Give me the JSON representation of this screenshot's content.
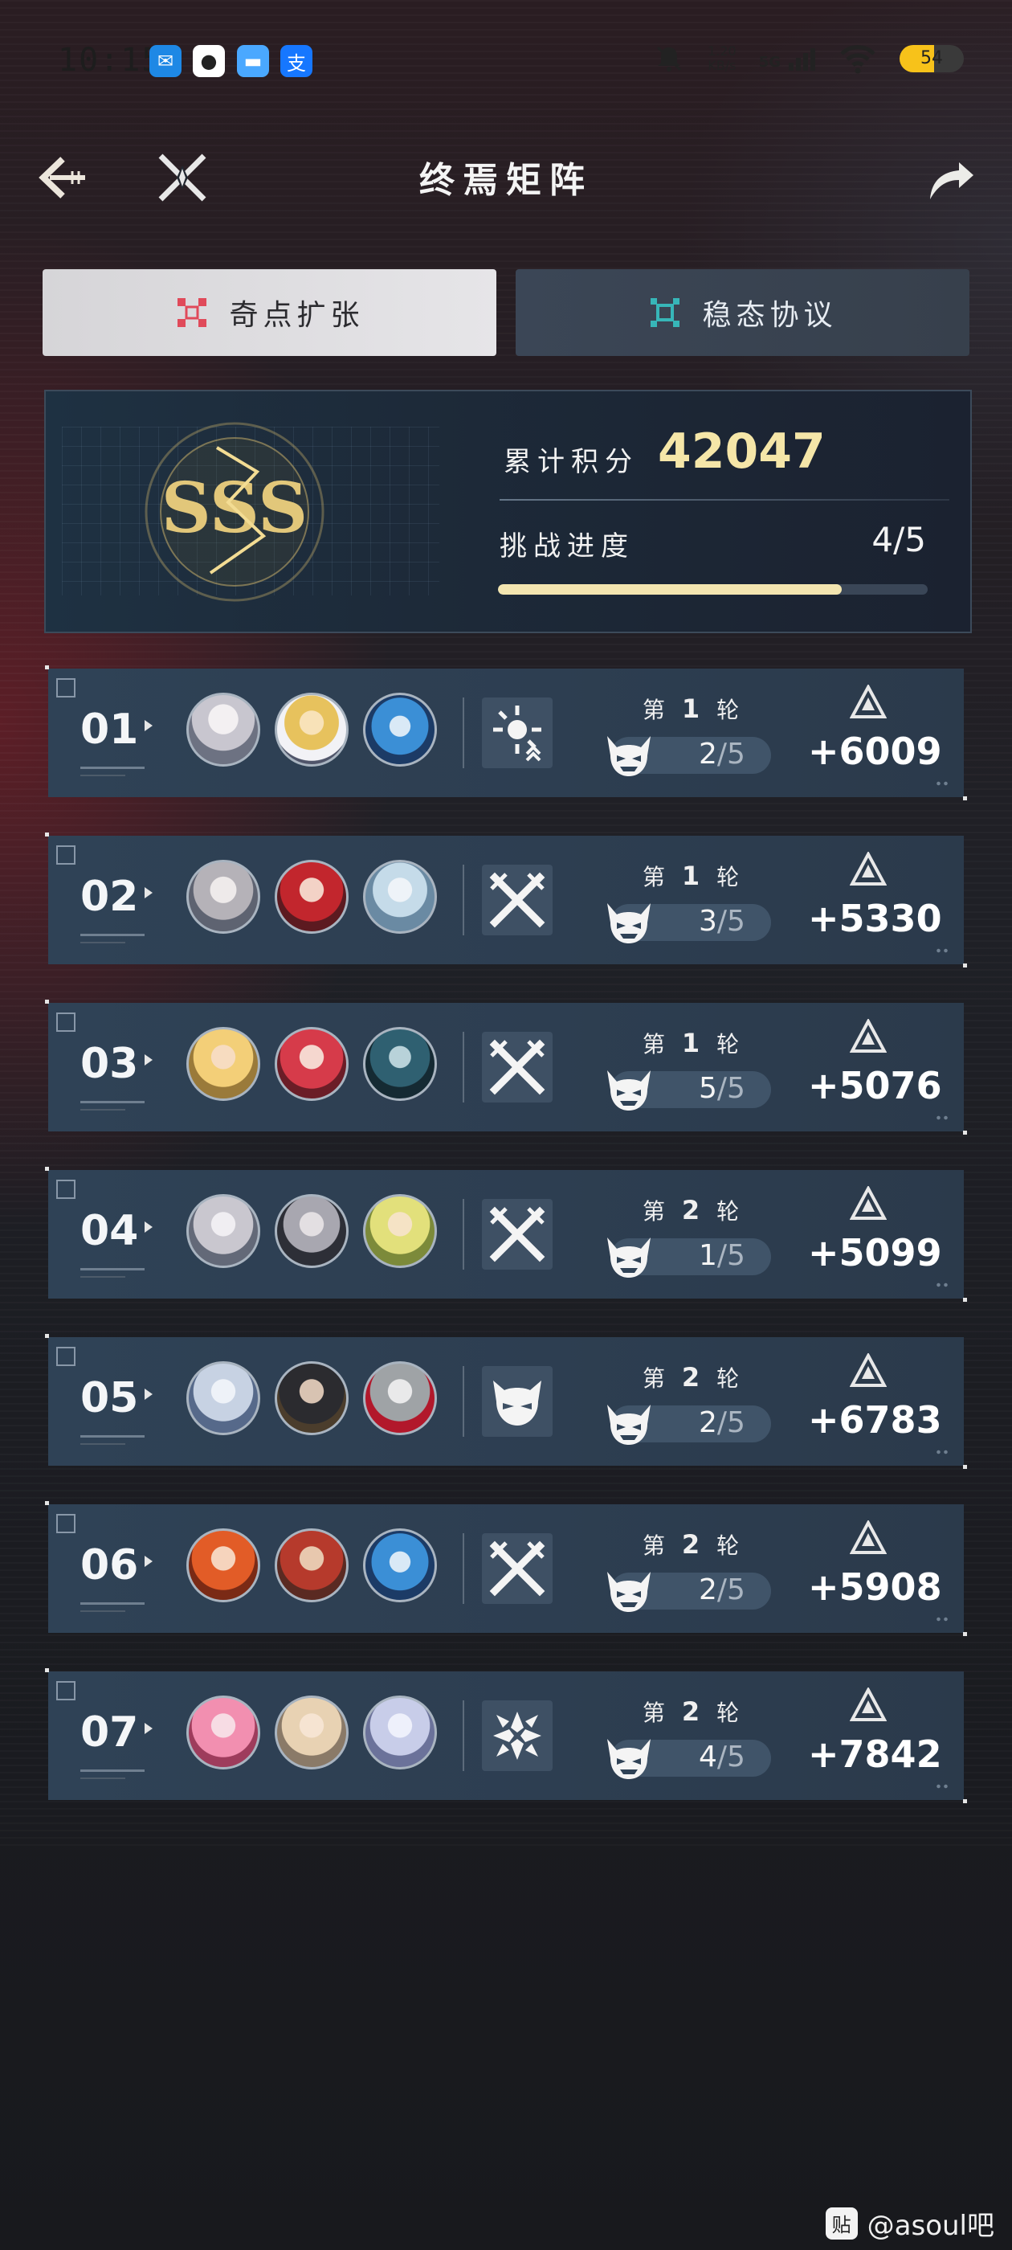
{
  "status_bar": {
    "time": "10:15",
    "net_speed": "1.20\nKB/s",
    "signal": "5G",
    "battery": "54",
    "battery_level": 0.54,
    "notifications": [
      "message-app-icon",
      "qq-icon",
      "wallet-card-icon",
      "alipay-icon"
    ]
  },
  "header": {
    "title": "终焉矩阵",
    "back_icon": "back-arrow-icon",
    "cross_icon": "crossed-swords-icon",
    "share_icon": "share-arrow-icon"
  },
  "tabs": [
    {
      "label": "奇点扩张",
      "icon": "singularity-icon",
      "active": true,
      "accent": "#e04a5a"
    },
    {
      "label": "稳态协议",
      "icon": "stable-protocol-icon",
      "active": false,
      "accent": "#37b6b8"
    }
  ],
  "summary": {
    "rank": "SSS",
    "score_label": "累计积分",
    "score": "42047",
    "progress_label": "挑战进度",
    "progress": "4/5",
    "progress_fraction": 0.8
  },
  "stages": [
    {
      "num": "01",
      "round": "1",
      "attempts": "2",
      "max": "/5",
      "score": "+6009",
      "buff_icon": "radiant-sun-icon",
      "avatars": [
        "av-a",
        "av-b",
        "av-c"
      ]
    },
    {
      "num": "02",
      "round": "1",
      "attempts": "3",
      "max": "/5",
      "score": "+5330",
      "buff_icon": "crossed-blades-icon",
      "avatars": [
        "av-d",
        "av-e",
        "av-f"
      ]
    },
    {
      "num": "03",
      "round": "1",
      "attempts": "5",
      "max": "/5",
      "score": "+5076",
      "buff_icon": "crossed-blades-icon",
      "avatars": [
        "av-g",
        "av-h",
        "av-i"
      ]
    },
    {
      "num": "04",
      "round": "2",
      "attempts": "1",
      "max": "/5",
      "score": "+5099",
      "buff_icon": "crossed-blades-icon",
      "avatars": [
        "av-j",
        "av-k",
        "av-l"
      ]
    },
    {
      "num": "05",
      "round": "2",
      "attempts": "2",
      "max": "/5",
      "score": "+6783",
      "buff_icon": "horned-mask-icon",
      "avatars": [
        "av-m",
        "av-n",
        "av-o"
      ]
    },
    {
      "num": "06",
      "round": "2",
      "attempts": "2",
      "max": "/5",
      "score": "+5908",
      "buff_icon": "crossed-blades-icon",
      "avatars": [
        "av-p",
        "av-q",
        "av-c"
      ]
    },
    {
      "num": "07",
      "round": "2",
      "attempts": "4",
      "max": "/5",
      "score": "+7842",
      "buff_icon": "converging-arrows-icon",
      "avatars": [
        "av-r",
        "av-s",
        "av-t"
      ]
    }
  ],
  "labels": {
    "round_prefix": "第",
    "round_suffix": "轮"
  },
  "watermark": {
    "icon_text": "贴",
    "text": "@asoul吧"
  },
  "colors": {
    "score_gold": "#f5e6a8",
    "progress_fill": "#f3e5b0",
    "row_bg": "#2f4256"
  }
}
